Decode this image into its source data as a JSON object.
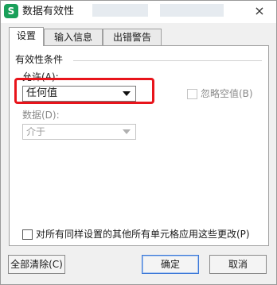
{
  "window": {
    "title": "数据有效性",
    "app_icon_letter": "S",
    "close_glyph": "×"
  },
  "tabs": [
    {
      "label": "设置",
      "active": true
    },
    {
      "label": "输入信息",
      "active": false
    },
    {
      "label": "出错警告",
      "active": false
    }
  ],
  "settings": {
    "group_title": "有效性条件",
    "allow_label": "允许(A):",
    "allow_value": "任何值",
    "ignore_blank_label": "忽略空值(B)",
    "ignore_blank_checked": false,
    "data_label": "数据(D):",
    "data_value": "介于",
    "apply_all_label": "对所有同样设置的其他所有单元格应用这些更改(P)",
    "apply_all_checked": false
  },
  "buttons": {
    "clear_all": "全部清除(C)",
    "ok": "确定",
    "cancel": "取消"
  },
  "colors": {
    "highlight": "#e8141b",
    "app_icon": "#1aa05a"
  }
}
